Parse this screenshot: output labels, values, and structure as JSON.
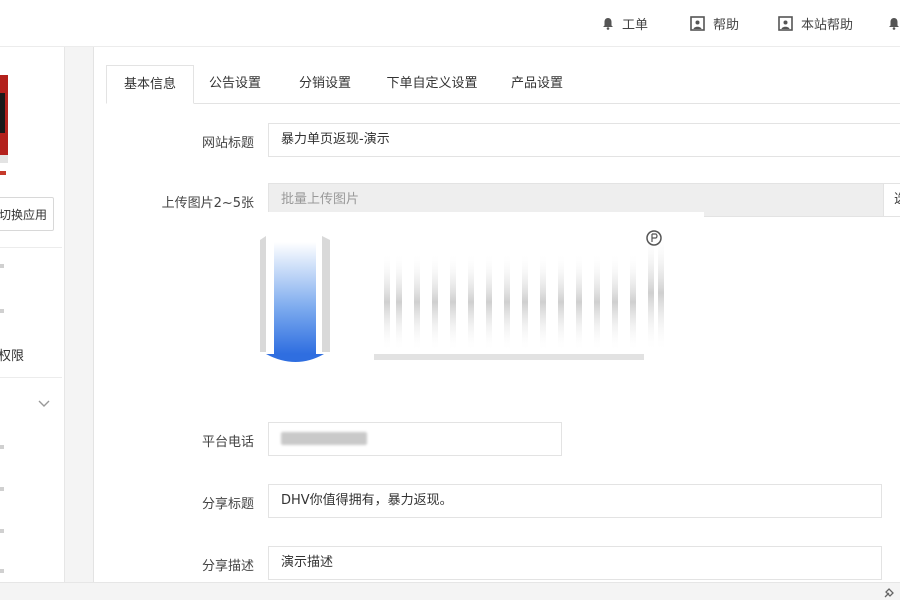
{
  "header": {
    "links": [
      {
        "label": "工单",
        "icon": "bell-icon"
      },
      {
        "label": "帮助",
        "icon": "help-icon"
      },
      {
        "label": "本站帮助",
        "icon": "help-icon"
      },
      {
        "label": "",
        "icon": "bell-icon"
      }
    ]
  },
  "sidebar": {
    "switch_app_label": "切换应用",
    "partial_item": "权限"
  },
  "tabs": [
    {
      "label": "基本信息",
      "active": true
    },
    {
      "label": "公告设置",
      "active": false
    },
    {
      "label": "分销设置",
      "active": false
    },
    {
      "label": "下单自定义设置",
      "active": false
    },
    {
      "label": "产品设置",
      "active": false
    }
  ],
  "form": {
    "site_title": {
      "label": "网站标题",
      "value": "暴力单页返现-演示"
    },
    "upload_images": {
      "label": "上传图片2~5张",
      "placeholder": "批量上传图片",
      "button_label": "选"
    },
    "platform_phone": {
      "label": "平台电话"
    },
    "share_title": {
      "label": "分享标题",
      "value": "DHV你值得拥有，暴力返现。"
    },
    "share_desc": {
      "label": "分享描述",
      "value": "演示描述"
    }
  },
  "colors": {
    "accent_blue": "#3b7ddd",
    "border": "#e3e3e3",
    "readonly_bg": "#eeeeee"
  }
}
